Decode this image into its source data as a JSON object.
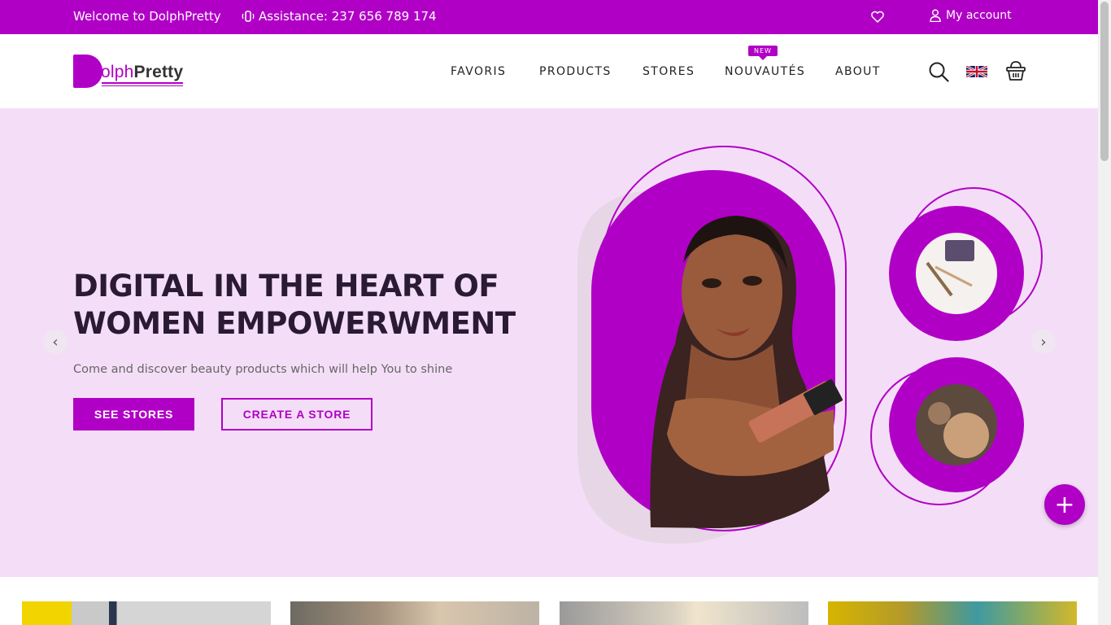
{
  "topbar": {
    "welcome": "Welcome to DolphPretty",
    "assistance": "Assistance: 237 656 789 174",
    "account": "My account"
  },
  "header": {
    "logo_part1": "olph",
    "logo_part2": "Pretty",
    "nav": {
      "favoris": "FAVORIS",
      "products": "PRODUCTS",
      "stores": "STORES",
      "nouveautes": "NOUVAUTÉS",
      "about": "ABOUT"
    },
    "new_badge": "NEW",
    "icons": [
      "search-icon",
      "uk-flag-icon",
      "basket-icon"
    ]
  },
  "hero": {
    "title_line1": "DIGITAL IN THE HEART OF",
    "title_line2": "WOMEN EMPOWERWMENT",
    "subtitle": "Come and discover beauty products which will help You to shine",
    "see_stores": "SEE STORES",
    "create_store": "CREATE A STORE",
    "prev_arrow": "‹",
    "next_arrow": "›"
  },
  "fab": "+",
  "colors": {
    "brand": "#b100c6",
    "hero_bg": "#f4def7",
    "heading": "#2a1a33"
  }
}
